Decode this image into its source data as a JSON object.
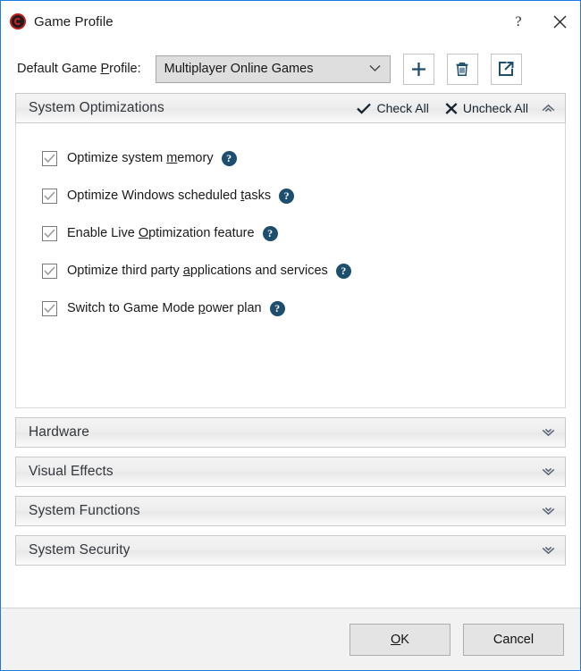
{
  "window": {
    "title": "Game Profile",
    "icon": "game-profile-icon",
    "border_color": "#1b7ae4",
    "help_button": "?",
    "close_button": "✕"
  },
  "profile": {
    "label_prefix": "Default Game ",
    "label_accel": "P",
    "label_suffix": "rofile:",
    "selected_value": "Multiplayer Online Games",
    "dropdown_icon": "chevron-down-icon",
    "buttons": [
      {
        "name": "add-profile-button",
        "icon": "plus-icon"
      },
      {
        "name": "delete-profile-button",
        "icon": "trash-icon"
      },
      {
        "name": "export-profile-button",
        "icon": "export-icon"
      }
    ]
  },
  "sections": {
    "expanded": {
      "title": "System Optimizations",
      "check_all_label": "Check All",
      "check_all_icon": "checkmark-icon",
      "uncheck_all_label": "Uncheck All",
      "uncheck_all_icon": "cross-icon",
      "toggle_icon": "chevron-up-icon",
      "options": [
        {
          "pre": "Optimize system ",
          "accel": "m",
          "post": "emory",
          "checked": true,
          "help": "?"
        },
        {
          "pre": "Optimize Windows scheduled ",
          "accel": "t",
          "post": "asks",
          "checked": true,
          "help": "?"
        },
        {
          "pre": "Enable Live ",
          "accel": "O",
          "post": "ptimization feature",
          "checked": true,
          "help": "?"
        },
        {
          "pre": "Optimize third party ",
          "accel": "a",
          "post": "pplications and services",
          "checked": true,
          "help": "?"
        },
        {
          "pre": "Switch to Game Mode ",
          "accel": "p",
          "post": "ower plan",
          "checked": true,
          "help": "?"
        }
      ]
    },
    "collapsed": [
      {
        "title": "Hardware",
        "toggle_icon": "chevron-down-icon"
      },
      {
        "title": "Visual Effects",
        "toggle_icon": "chevron-down-icon"
      },
      {
        "title": "System Functions",
        "toggle_icon": "chevron-down-icon"
      },
      {
        "title": "System Security",
        "toggle_icon": "chevron-down-icon"
      }
    ]
  },
  "footer": {
    "ok_accel": "O",
    "ok_rest": "K",
    "cancel_label": "Cancel"
  },
  "colors": {
    "accent_blue": "#1b7ae4",
    "help_badge": "#1d4e6e",
    "action_navy": "#16232e",
    "title_icon_red": "#c01a1a"
  }
}
